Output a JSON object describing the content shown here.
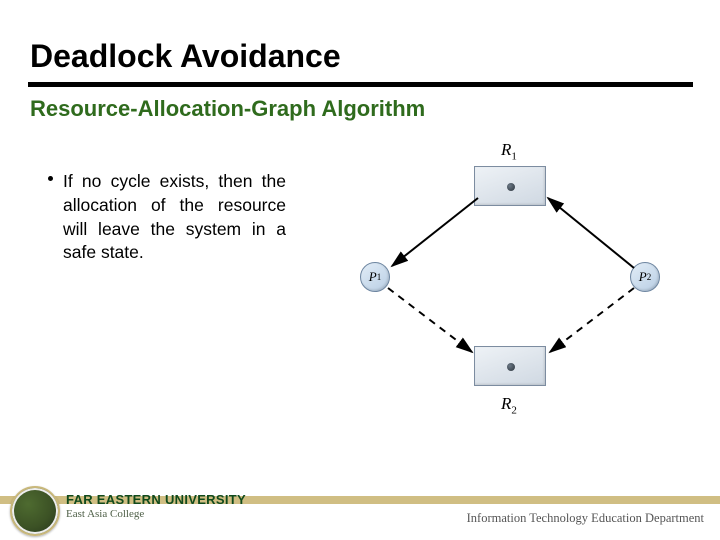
{
  "title": "Deadlock Avoidance",
  "subtitle": "Resource-Allocation-Graph Algorithm",
  "bullet": "If no cycle exists, then the allocation of the resource will leave the system in a safe state.",
  "diagram": {
    "R1": "R",
    "R1_sub": "1",
    "R2": "R",
    "R2_sub": "2",
    "P1": "P",
    "P1_sub": "1",
    "P2": "P",
    "P2_sub": "2"
  },
  "footer": {
    "university": "FAR EASTERN UNIVERSITY",
    "college": "East Asia College",
    "department": "Information Technology Education Department"
  }
}
